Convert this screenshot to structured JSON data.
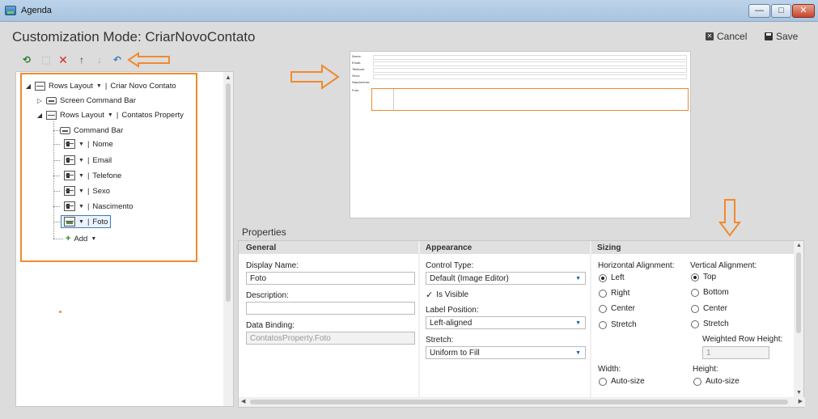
{
  "window": {
    "title": "Agenda",
    "minimize": "—",
    "maximize": "□",
    "close": "✕"
  },
  "header": {
    "title": "Customization Mode: CriarNovoContato",
    "cancel_label": "Cancel",
    "save_label": "Save"
  },
  "toolbar": {
    "icons": [
      "add-icon",
      "copy-icon",
      "delete-icon",
      "move-up-icon",
      "move-down-icon",
      "undo-icon"
    ]
  },
  "tree": {
    "root": {
      "type": "Rows Layout",
      "label": "Criar Novo Contato"
    },
    "screen_command_bar": "Screen Command Bar",
    "contatos": {
      "type": "Rows Layout",
      "label": "Contatos Property"
    },
    "command_bar": "Command Bar",
    "fields": [
      "Nome",
      "Email",
      "Telefone",
      "Sexo",
      "Nascimento",
      "Foto"
    ],
    "add_label": "Add"
  },
  "preview": {
    "labels": [
      "Nome:",
      "Email:",
      "Telefone:",
      "Sexo:",
      "Nascimento:",
      "Foto:"
    ]
  },
  "properties": {
    "title": "Properties",
    "general": {
      "heading": "General",
      "display_name_label": "Display Name:",
      "display_name_value": "Foto",
      "description_label": "Description:",
      "description_value": "",
      "data_binding_label": "Data Binding:",
      "data_binding_value": "ContatosProperty.Foto"
    },
    "appearance": {
      "heading": "Appearance",
      "control_type_label": "Control Type:",
      "control_type_value": "Default (Image Editor)",
      "is_visible_label": "Is Visible",
      "is_visible": true,
      "label_position_label": "Label Position:",
      "label_position_value": "Left-aligned",
      "stretch_label": "Stretch:",
      "stretch_value": "Uniform to Fill"
    },
    "sizing": {
      "heading": "Sizing",
      "horizontal_label": "Horizontal Alignment:",
      "horizontal_options": [
        "Left",
        "Right",
        "Center",
        "Stretch"
      ],
      "horizontal_selected": "Left",
      "vertical_label": "Vertical Alignment:",
      "vertical_options": [
        "Top",
        "Bottom",
        "Center",
        "Stretch"
      ],
      "vertical_selected": "Top",
      "weighted_row_height_label": "Weighted Row Height:",
      "weighted_row_height_value": "1",
      "width_label": "Width:",
      "width_value": "Auto-size",
      "height_label": "Height:",
      "height_value": "Auto-size"
    }
  },
  "colors": {
    "highlight": "#f08a2e",
    "selection": "#3a7ac0"
  }
}
